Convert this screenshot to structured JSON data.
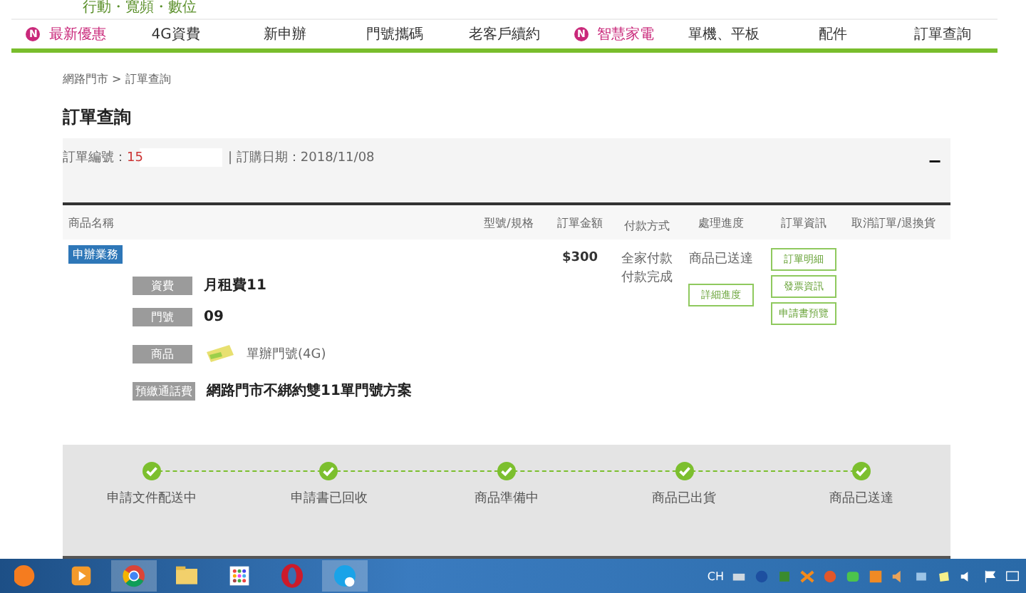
{
  "header": {
    "tagline": "行動・寬頻・數位"
  },
  "nav": [
    {
      "label": "最新優惠",
      "badge": "N",
      "highlight": true
    },
    {
      "label": "4G資費",
      "highlight": false
    },
    {
      "label": "新申辦",
      "highlight": false
    },
    {
      "label": "門號攜碼",
      "highlight": false
    },
    {
      "label": "老客戶續約",
      "highlight": false
    },
    {
      "label": "智慧家電",
      "badge": "N",
      "highlight": true
    },
    {
      "label": "單機、平板",
      "highlight": false
    },
    {
      "label": "配件",
      "highlight": false
    },
    {
      "label": "訂單查詢",
      "highlight": false
    }
  ],
  "breadcrumb": "網路門市 > 訂單查詢",
  "page_title": "訂單查詢",
  "order": {
    "number_label": "訂單編號：",
    "number": "15",
    "date": "| 訂購日期：2018/11/08",
    "collapse": "−"
  },
  "table": {
    "columns": [
      "商品名稱",
      "型號/規格",
      "訂單金額",
      "付款方式",
      "處理進度",
      "訂單資訊",
      "取消訂單/退換貨"
    ],
    "row": {
      "tag": "申辦業務",
      "details": [
        {
          "label": "資費",
          "value": "月租費11",
          "kind": "text"
        },
        {
          "label": "門號",
          "value": "09",
          "kind": "text"
        },
        {
          "label": "商品",
          "value": "單辦門號(4G)",
          "kind": "product"
        },
        {
          "label": "預繳通話費",
          "value": "網路門市不綁約雙11單門號方案",
          "kind": "text"
        }
      ],
      "amount": "$300",
      "payment": [
        "全家付款",
        "付款完成"
      ],
      "status": "商品已送達",
      "status_button": "詳細進度",
      "info_buttons": [
        "訂單明細",
        "發票資訊",
        "申請書預覽"
      ]
    }
  },
  "progress": [
    {
      "label": "申請文件配送中",
      "done": true
    },
    {
      "label": "申請書已回收",
      "done": true
    },
    {
      "label": "商品準備中",
      "done": true
    },
    {
      "label": "商品已出貨",
      "done": true
    },
    {
      "label": "商品已送達",
      "done": true
    }
  ],
  "taskbar": {
    "tray_language": "CH"
  }
}
